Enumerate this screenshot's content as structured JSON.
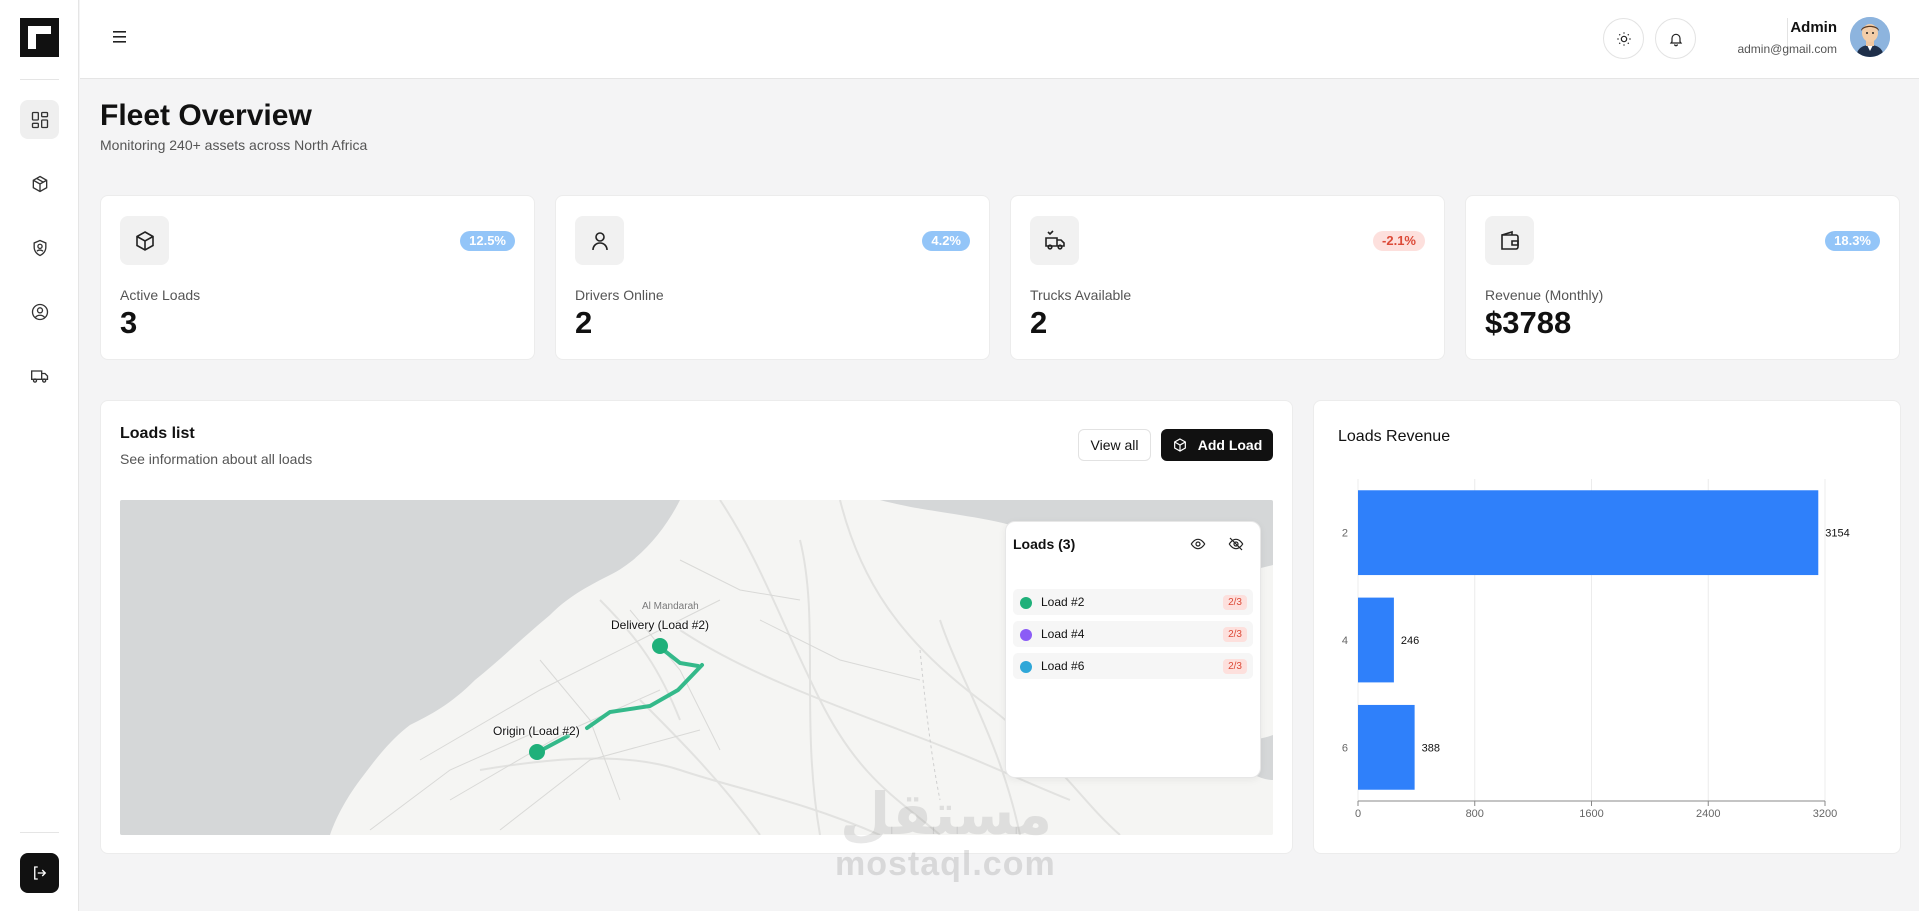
{
  "header": {
    "user_name": "Admin",
    "user_email": "admin@gmail.com"
  },
  "page": {
    "title": "Fleet Overview",
    "subtitle": "Monitoring 240+ assets across North Africa"
  },
  "stats": [
    {
      "label": "Active Loads",
      "value": "3",
      "change": "12.5%",
      "trend": "positive",
      "icon": "box-icon"
    },
    {
      "label": "Drivers Online",
      "value": "2",
      "change": "4.2%",
      "trend": "positive",
      "icon": "user-icon"
    },
    {
      "label": "Trucks Available",
      "value": "2",
      "change": "-2.1%",
      "trend": "negative",
      "icon": "truck-icon"
    },
    {
      "label": "Revenue (Monthly)",
      "value": "$3788",
      "change": "18.3%",
      "trend": "positive",
      "icon": "wallet-icon"
    }
  ],
  "loads": {
    "title": "Loads list",
    "subtitle": "See information about all loads",
    "view_all": "View all",
    "add_load": "Add Load",
    "map": {
      "place": "Al Mandarah",
      "origin_label": "Origin (Load #2)",
      "delivery_label": "Delivery (Load #2)",
      "route_color": "#34b98a"
    },
    "panel_title": "Loads (3)",
    "items": [
      {
        "name": "Load #2",
        "count": "2/3",
        "color": "#1fb07a"
      },
      {
        "name": "Load #4",
        "count": "2/3",
        "color": "#8b5cf6"
      },
      {
        "name": "Load #6",
        "count": "2/3",
        "color": "#2fa7d8"
      }
    ]
  },
  "revenue": {
    "title": "Loads Revenue"
  },
  "chart_data": {
    "type": "bar",
    "orientation": "horizontal",
    "title": "Loads Revenue",
    "categories": [
      "2",
      "4",
      "6"
    ],
    "values": [
      3154,
      246,
      388
    ],
    "xlim": [
      0,
      3200
    ],
    "xticks": [
      0,
      800,
      1600,
      2400,
      3200
    ],
    "bar_color": "#2f80fa",
    "grid": true
  },
  "watermark": {
    "latin": "mostaql.com",
    "arabic": "مستقل"
  }
}
